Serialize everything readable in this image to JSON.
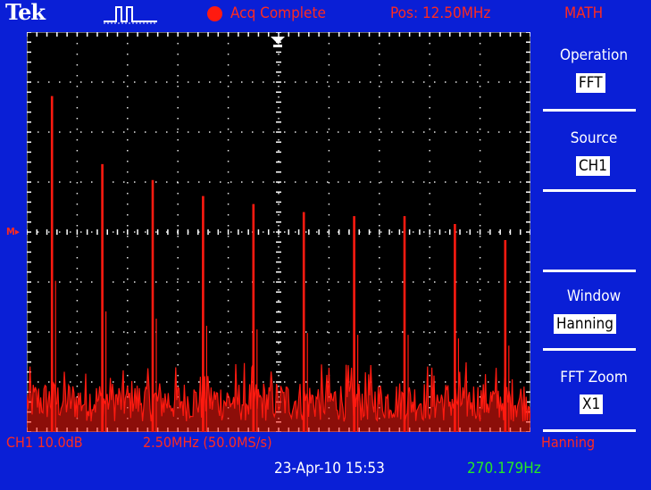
{
  "header": {
    "logo": "Tek",
    "acq_status": "Acq Complete",
    "position": "Pos: 12.50MHz",
    "menu_title": "MATH"
  },
  "menu": {
    "operation": {
      "label": "Operation",
      "value": "FFT"
    },
    "source": {
      "label": "Source",
      "value": "CH1"
    },
    "window": {
      "label": "Window",
      "value": "Hanning"
    },
    "fft_zoom": {
      "label": "FFT Zoom",
      "value": "X1"
    }
  },
  "footer": {
    "ch1_scale": "CH1 10.0dB",
    "timebase": "2.50MHz (50.0MS/s)",
    "window": "Hanning",
    "datetime": "23-Apr-10 15:53",
    "frequency": "270.179Hz"
  },
  "markers": {
    "reference": "M▸"
  },
  "colors": {
    "background": "#0a1fd6",
    "trace": "#ff1a10",
    "accent_red": "#ff2a20",
    "frequency_green": "#26e826",
    "grid": "#ffffff"
  },
  "spectrum": {
    "harmonic_peaks": [
      {
        "x": 0.05,
        "level": 0.84
      },
      {
        "x": 0.15,
        "level": 0.67
      },
      {
        "x": 0.25,
        "level": 0.63
      },
      {
        "x": 0.35,
        "level": 0.59
      },
      {
        "x": 0.45,
        "level": 0.57
      },
      {
        "x": 0.55,
        "level": 0.55
      },
      {
        "x": 0.65,
        "level": 0.54
      },
      {
        "x": 0.75,
        "level": 0.54
      },
      {
        "x": 0.85,
        "level": 0.52
      },
      {
        "x": 0.95,
        "level": 0.48
      }
    ],
    "noise_floor": 0.13
  }
}
